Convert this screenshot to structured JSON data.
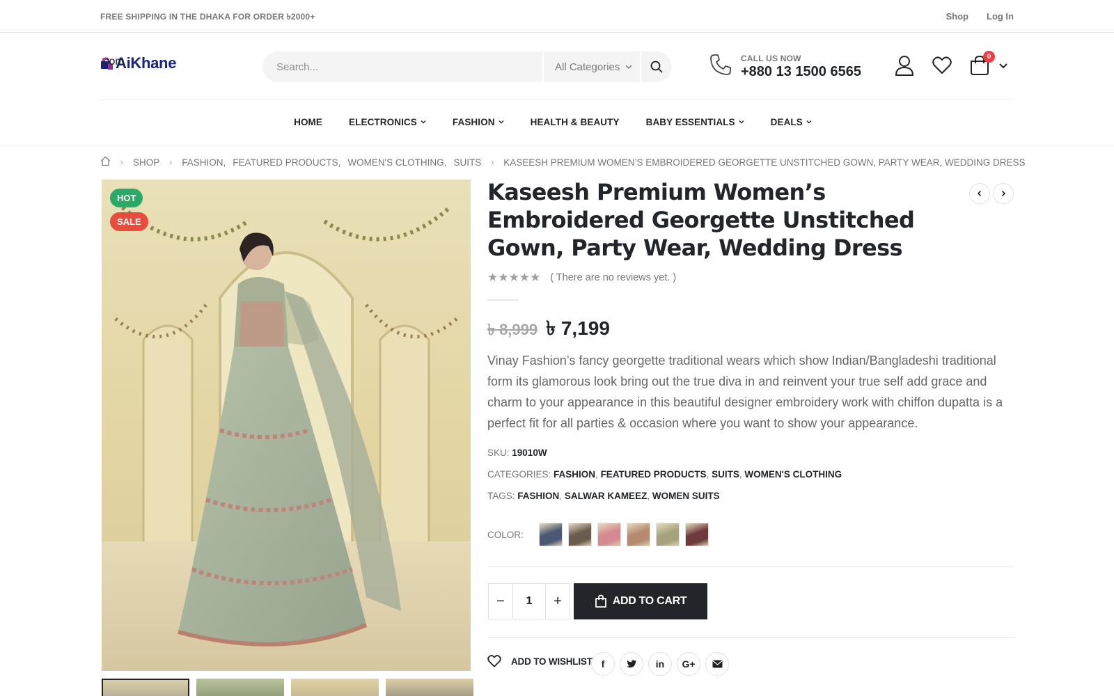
{
  "topbar": {
    "promo": "FREE SHIPPING IN THE DHAKA FOR ORDER ৳2000+",
    "links": [
      "Shop",
      "Log In"
    ]
  },
  "header": {
    "logo_main": "AiKhane",
    "logo_sub": ".com",
    "search_placeholder": "Search...",
    "category_select": "All Categories",
    "call_label": "CALL US NOW",
    "call_number": "+880 13 1500 6565",
    "cart_count": "0",
    "icons": [
      "phone-icon",
      "user-icon",
      "heart-icon",
      "cart-icon"
    ]
  },
  "nav": [
    {
      "label": "HOME",
      "dropdown": false
    },
    {
      "label": "ELECTRONICS",
      "dropdown": true
    },
    {
      "label": "FASHION",
      "dropdown": true
    },
    {
      "label": "HEALTH & BEAUTY",
      "dropdown": false
    },
    {
      "label": "BABY ESSENTIALS",
      "dropdown": true
    },
    {
      "label": "DEALS",
      "dropdown": true
    }
  ],
  "breadcrumb": {
    "shop": "SHOP",
    "categories": [
      "FASHION",
      "FEATURED PRODUCTS",
      "WOMEN'S CLOTHING",
      "SUITS"
    ],
    "current": "KASEESH PREMIUM WOMEN’S EMBROIDERED GEORGETTE UNSTITCHED GOWN, PARTY WEAR, WEDDING DRESS"
  },
  "badges": {
    "hot": "HOT",
    "sale": "SALE"
  },
  "product": {
    "title": "Kaseesh Premium Women’s Embroidered Georgette Unstitched Gown, Party Wear, Wedding Dress",
    "reviews": "( There are no reviews yet. )",
    "rating": 0,
    "price_old": "৳ 8,999",
    "price_new": "৳ 7,199",
    "description": "Vinay Fashion’s fancy georgette traditional wears which show Indian/Bangladeshi traditional form its glamorous look bring out the true diva in and reinvent your true self add grace and charm to your appearance in this beautiful designer embroidery work with chiffon dupatta is a perfect fit for all parties & occasion where you want to show your appearance.",
    "sku_label": "SKU:",
    "sku": "19010W",
    "categories_label": "CATEGORIES:",
    "categories": [
      "FASHION",
      "FEATURED PRODUCTS",
      "SUITS",
      "WOMEN'S CLOTHING"
    ],
    "tags_label": "TAGS:",
    "tags": [
      "FASHION",
      "SALWAR KAMEEZ",
      "WOMEN SUITS"
    ],
    "color_label": "COLOR:",
    "swatch_colors": [
      "#4a5873",
      "#6b5a4e",
      "#d48a90",
      "#b58a6e",
      "#a7a27e",
      "#6e3a3c"
    ],
    "quantity": "1",
    "add_to_cart": "ADD TO CART",
    "wishlist": "ADD TO WISHLIST",
    "share": [
      "f",
      "t",
      "in",
      "G+",
      "mail"
    ]
  },
  "colors": {
    "accent_dark": "#222529",
    "hot": "#2ba968",
    "sale": "#e74c3c",
    "badge": "#ee3d43"
  }
}
